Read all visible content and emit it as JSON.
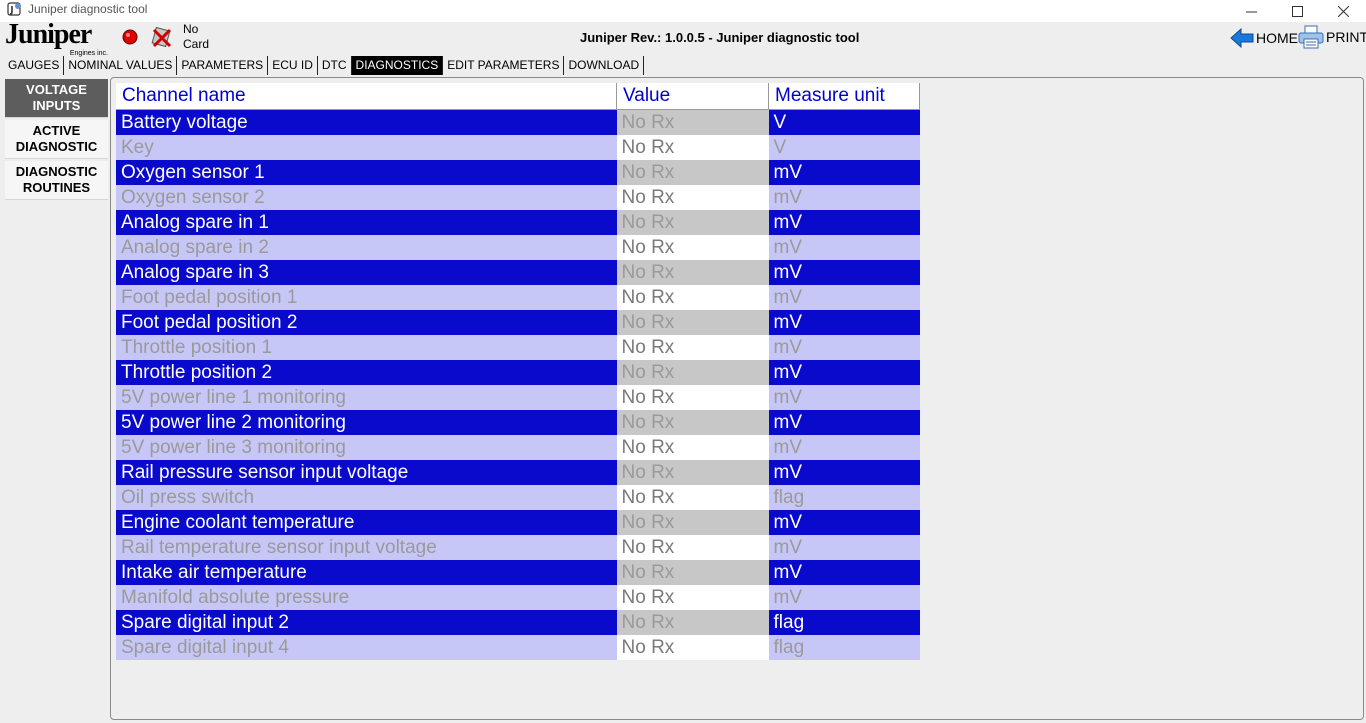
{
  "window": {
    "title": "Juniper diagnostic tool"
  },
  "header": {
    "logo_text": "Juniper",
    "logo_subtext": "Engines inc.",
    "card_status_line1": "No",
    "card_status_line2": "Card",
    "app_title": "Juniper Rev.: 1.0.0.5 - Juniper diagnostic tool",
    "home_label": "HOME",
    "print_label": "PRINT"
  },
  "tabs": [
    {
      "label": "GAUGES"
    },
    {
      "label": "NOMINAL VALUES"
    },
    {
      "label": "PARAMETERS"
    },
    {
      "label": "ECU ID"
    },
    {
      "label": "DTC"
    },
    {
      "label": "DIAGNOSTICS"
    },
    {
      "label": "EDIT PARAMETERS"
    },
    {
      "label": "DOWNLOAD"
    }
  ],
  "active_tab": "DIAGNOSTICS",
  "sidebar": {
    "items": [
      {
        "line1": "VOLTAGE",
        "line2": "INPUTS"
      },
      {
        "line1": "ACTIVE",
        "line2": "DIAGNOSTIC"
      },
      {
        "line1": "DIAGNOSTIC",
        "line2": "ROUTINES"
      }
    ],
    "active": "VOLTAGE INPUTS"
  },
  "table": {
    "headers": {
      "name": "Channel name",
      "value": "Value",
      "unit": "Measure unit"
    },
    "rows": [
      {
        "name": "Battery voltage",
        "value": "No Rx",
        "unit": "V"
      },
      {
        "name": "Key",
        "value": "No Rx",
        "unit": "V"
      },
      {
        "name": "Oxygen sensor 1",
        "value": "No Rx",
        "unit": "mV"
      },
      {
        "name": "Oxygen sensor 2",
        "value": "No Rx",
        "unit": "mV"
      },
      {
        "name": "Analog spare in 1",
        "value": "No Rx",
        "unit": "mV"
      },
      {
        "name": "Analog spare in 2",
        "value": "No Rx",
        "unit": "mV"
      },
      {
        "name": "Analog spare in 3",
        "value": "No Rx",
        "unit": "mV"
      },
      {
        "name": "Foot pedal position 1",
        "value": "No Rx",
        "unit": "mV"
      },
      {
        "name": "Foot pedal position 2",
        "value": "No Rx",
        "unit": "mV"
      },
      {
        "name": "Throttle position 1",
        "value": "No Rx",
        "unit": "mV"
      },
      {
        "name": "Throttle position 2",
        "value": "No Rx",
        "unit": "mV"
      },
      {
        "name": "5V power line 1 monitoring",
        "value": "No Rx",
        "unit": "mV"
      },
      {
        "name": "5V power line 2 monitoring",
        "value": "No Rx",
        "unit": "mV"
      },
      {
        "name": "5V power line 3 monitoring",
        "value": "No Rx",
        "unit": "mV"
      },
      {
        "name": "Rail pressure sensor input voltage",
        "value": "No Rx",
        "unit": "mV"
      },
      {
        "name": "Oil press switch",
        "value": "No Rx",
        "unit": "flag"
      },
      {
        "name": "Engine coolant temperature",
        "value": "No Rx",
        "unit": "mV"
      },
      {
        "name": "Rail temperature sensor input voltage",
        "value": "No Rx",
        "unit": "mV"
      },
      {
        "name": "Intake air temperature",
        "value": "No Rx",
        "unit": "mV"
      },
      {
        "name": "Manifold absolute pressure",
        "value": "No Rx",
        "unit": "mV"
      },
      {
        "name": "Spare digital input 2",
        "value": "No Rx",
        "unit": "flag"
      },
      {
        "name": "Spare digital input 4",
        "value": "No Rx",
        "unit": "flag"
      }
    ]
  },
  "colors": {
    "row_highlight": "#0a0acc",
    "row_light": "#c7c7f7",
    "header_text": "#0000d0",
    "active_tab_bg": "#000000",
    "active_side_bg": "#5d5d5d"
  },
  "icons": {
    "app": "app-icon",
    "record": "record-icon",
    "no_card": "no-card-icon",
    "home": "home-arrow-icon",
    "print": "printer-icon",
    "minimize": "minimize-icon",
    "maximize": "maximize-icon",
    "close": "close-icon"
  }
}
